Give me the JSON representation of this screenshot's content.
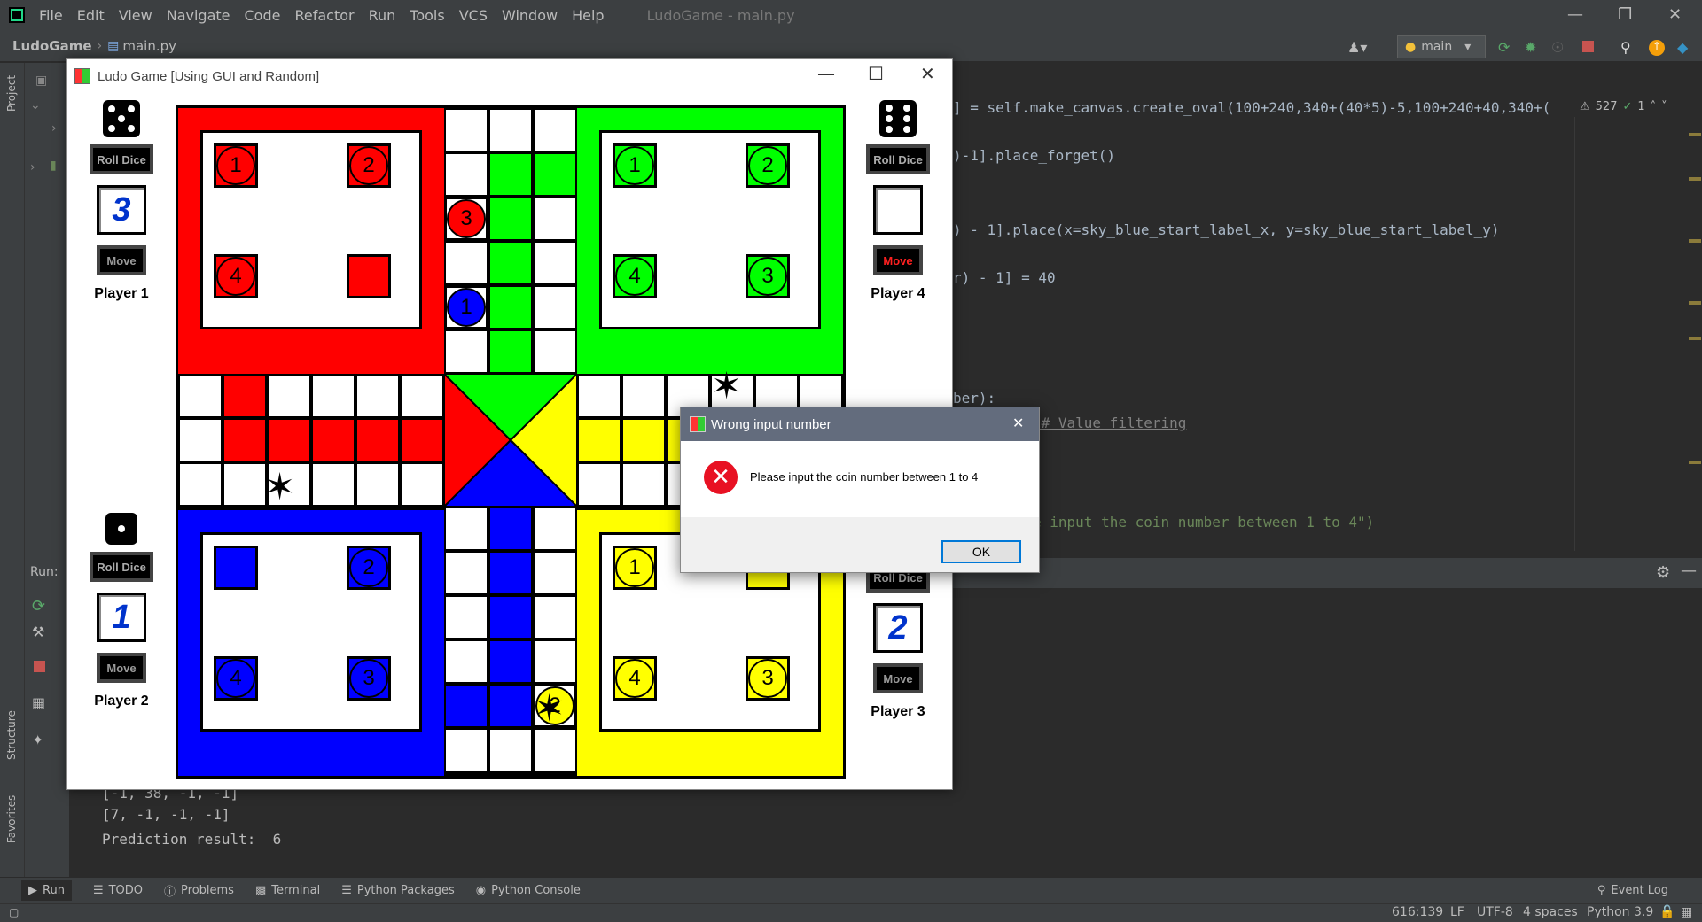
{
  "ide": {
    "menu": [
      "File",
      "Edit",
      "View",
      "Navigate",
      "Code",
      "Refactor",
      "Run",
      "Tools",
      "VCS",
      "Window",
      "Help"
    ],
    "window_title": "LudoGame - main.py",
    "breadcrumb_project": "LudoGame",
    "breadcrumb_file": "main.py",
    "run_config": "main",
    "warnings_count": "527",
    "checks_count": "1",
    "project_tab": "Project",
    "structure_tab": "Structure",
    "favorites_tab": "Favorites",
    "run_label": "Run:",
    "code_lines": [
      "] = self.make_canvas.create_oval(100+240,340+(40*5)-5,100+240+40,340+(",
      ")-1].place_forget()",
      ") - 1].place(x=sky_blue_start_label_x, y=sky_blue_start_label_y)",
      "r) - 1] = 40",
      "ber):",
      ")# Value filtering",
      "e input the coin number between 1 to 4\")"
    ],
    "output_lines": [
      "[-1, 38, -1, -1]",
      "[7, -1, -1, -1]",
      "Prediction result:  6"
    ],
    "tool_windows": [
      "Run",
      "TODO",
      "Problems",
      "Terminal",
      "Python Packages",
      "Python Console"
    ],
    "event_log": "Event Log",
    "status": {
      "position": "616:139",
      "line_sep": "LF",
      "encoding": "UTF-8",
      "indent": "4 spaces",
      "interpreter": "Python 3.9"
    }
  },
  "ludo": {
    "title": "Ludo Game [Using GUI and Random]",
    "roll_label": "Roll Dice",
    "move_label": "Move",
    "players": [
      {
        "name": "Player 1",
        "number": "3",
        "dice": 5
      },
      {
        "name": "Player 4",
        "number": "",
        "dice": 6
      },
      {
        "name": "Player 2",
        "number": "1",
        "dice": 1
      },
      {
        "name": "Player 3",
        "number": "2",
        "dice": 0
      }
    ],
    "colors": {
      "red": "#ff0000",
      "green": "#00ff00",
      "blue": "#0000ff",
      "yellow": "#ffff00"
    },
    "red_coins": [
      "1",
      "2",
      "4",
      ""
    ],
    "green_coins": [
      "1",
      "2",
      "4",
      "3"
    ],
    "blue_coins": [
      "",
      "2",
      "4",
      "3"
    ],
    "yellow_coins": [
      "1",
      "",
      "4",
      "3"
    ],
    "track_coins": {
      "red": "3",
      "blue": "1",
      "yellow": "2"
    }
  },
  "dialog": {
    "title": "Wrong input number",
    "message": "Please input the coin number between 1 to 4",
    "ok": "OK"
  }
}
